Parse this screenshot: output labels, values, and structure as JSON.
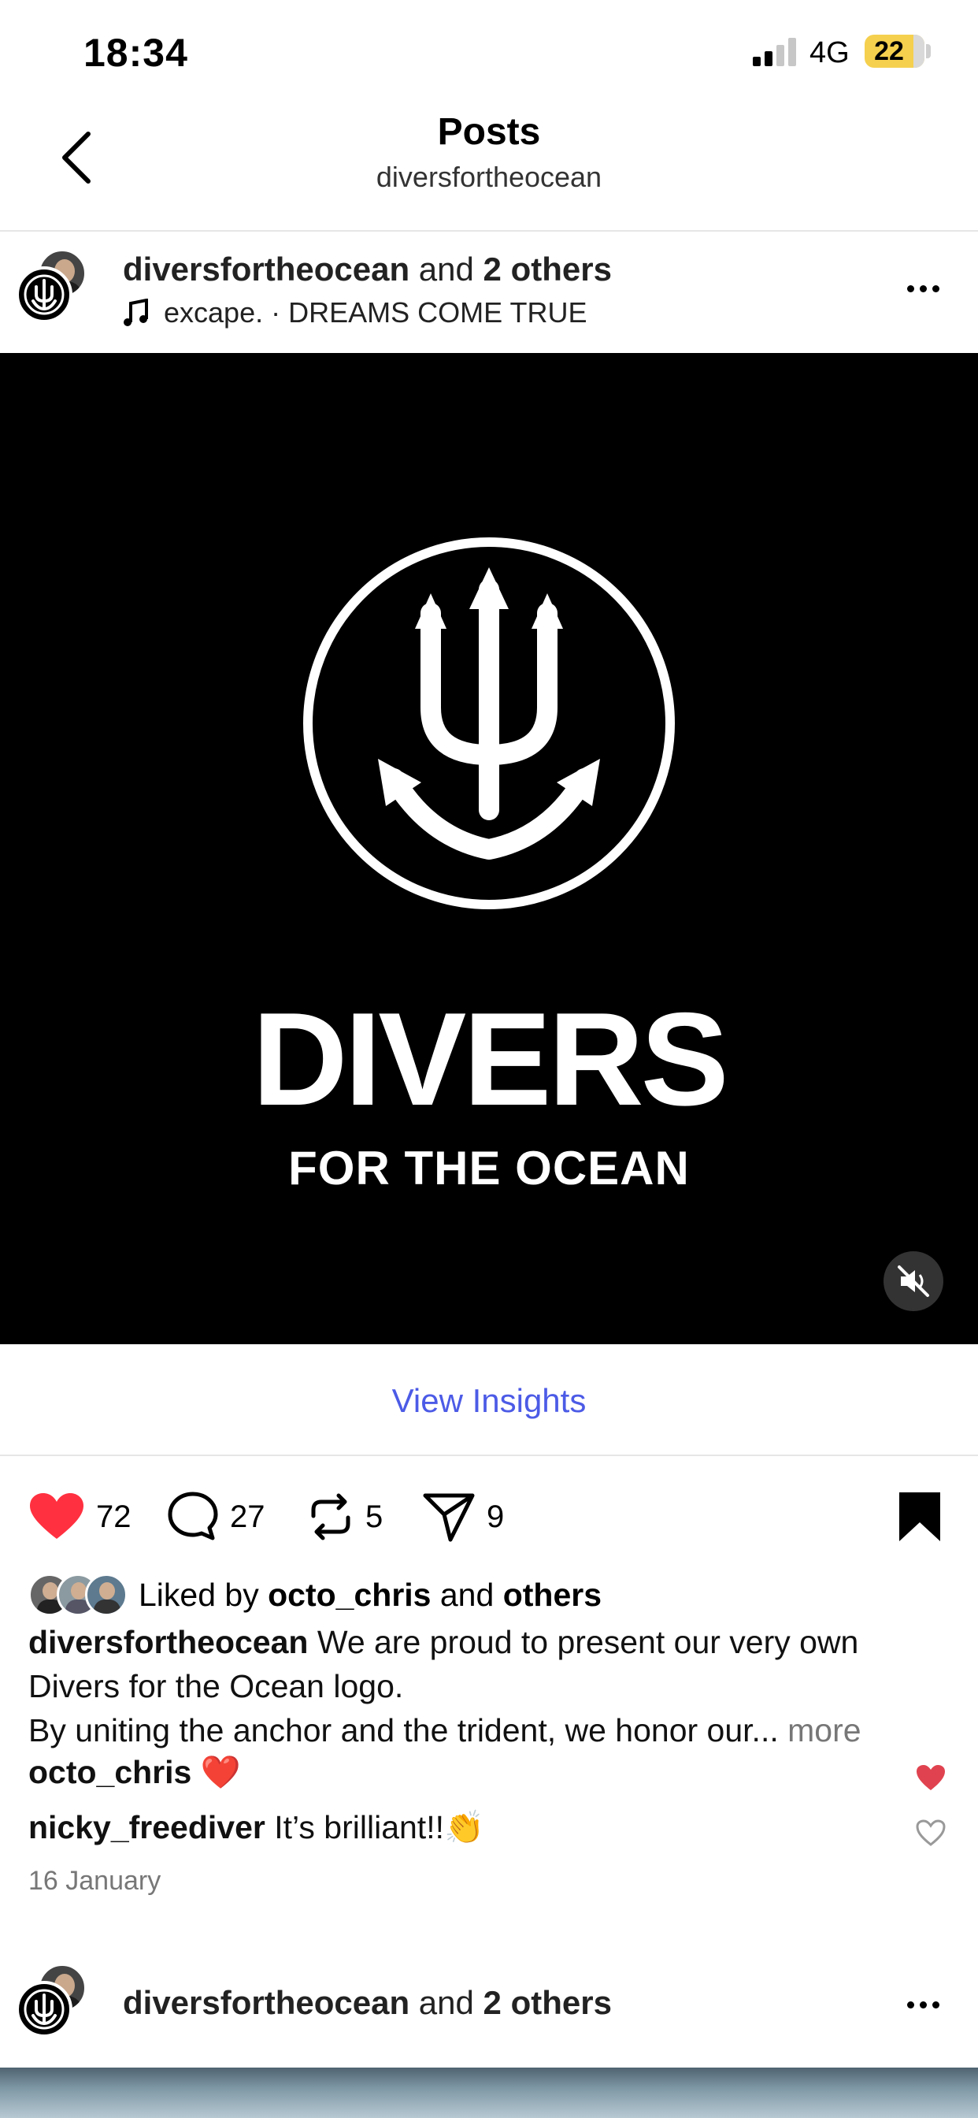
{
  "status_bar": {
    "time": "18:34",
    "network": "4G",
    "battery": "22"
  },
  "nav": {
    "title": "Posts",
    "subtitle": "diversfortheocean"
  },
  "post": {
    "username": "diversfortheocean",
    "collab_text": "and",
    "collab_count": "2 others",
    "music_artist": "excape.",
    "music_sep": "·",
    "music_title": "DREAMS COME TRUE",
    "media": {
      "brand_line1": "DIVERS",
      "brand_line2": "FOR THE OCEAN",
      "muted": true
    },
    "insights_label": "View Insights",
    "actions": {
      "likes": "72",
      "comments": "27",
      "reposts": "5",
      "shares": "9"
    },
    "liked_by": {
      "prefix": "Liked by",
      "user": "octo_chris",
      "and": "and",
      "others": "others"
    },
    "caption": {
      "user": "diversfortheocean",
      "text": "We are proud to present our very own Divers for the Ocean logo.",
      "line2": "By uniting the anchor and the trident, we honor our...",
      "more": "more"
    },
    "comments": [
      {
        "user": "octo_chris",
        "text": "❤️",
        "liked": true
      },
      {
        "user": "nicky_freediver",
        "text": "It’s brilliant!!👏",
        "liked": false
      }
    ],
    "date": "16 January"
  },
  "next_post": {
    "username": "diversfortheocean",
    "collab_text": "and",
    "collab_count": "2 others"
  },
  "colors": {
    "accent_link": "#4c5be6",
    "like_red": "#ff3040",
    "battery_yellow": "#f5d04e"
  }
}
